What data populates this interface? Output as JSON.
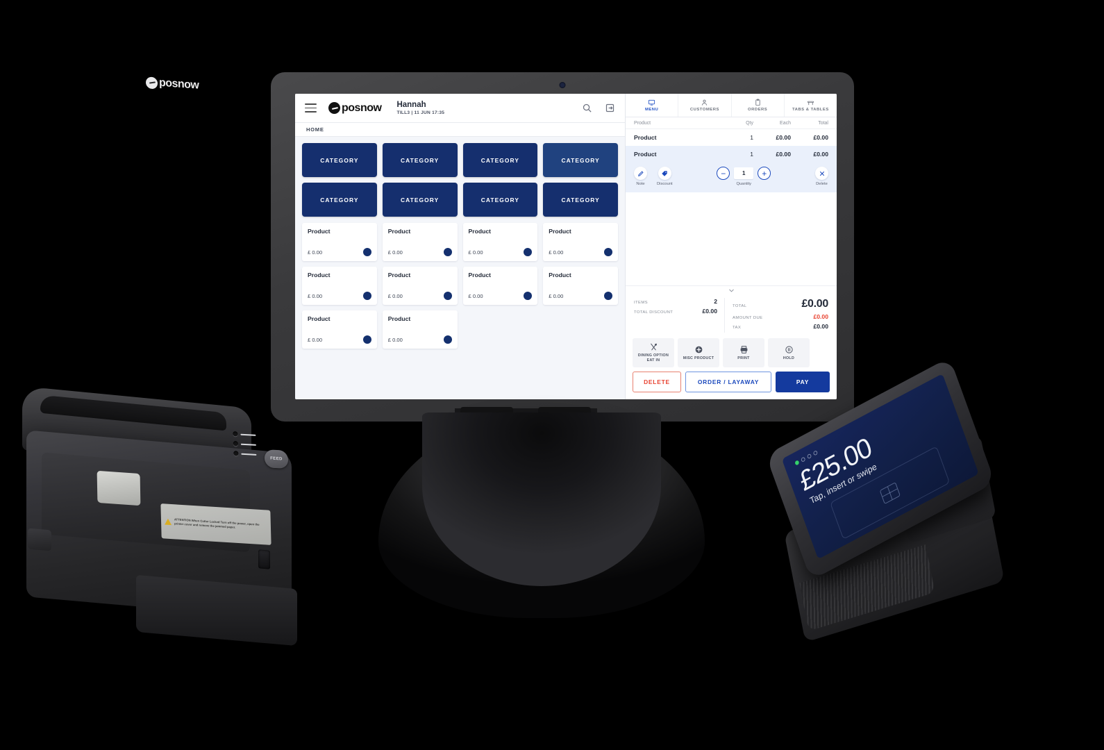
{
  "pos": {
    "header": {
      "menu_icon": "hamburger-icon",
      "brand": "posnow",
      "user_name": "Hannah",
      "till_meta": "TILL3 | 11 JUN 17:35",
      "search_icon": "search-icon",
      "login_icon": "login-icon"
    },
    "breadcrumb": "HOME",
    "categories": [
      {
        "label": "CATEGORY"
      },
      {
        "label": "CATEGORY"
      },
      {
        "label": "CATEGORY"
      },
      {
        "label": "CATEGORY"
      },
      {
        "label": "CATEGORY"
      },
      {
        "label": "CATEGORY"
      },
      {
        "label": "CATEGORY"
      },
      {
        "label": "CATEGORY"
      }
    ],
    "products": [
      {
        "name": "Product",
        "price": "£ 0.00"
      },
      {
        "name": "Product",
        "price": "£ 0.00"
      },
      {
        "name": "Product",
        "price": "£ 0.00"
      },
      {
        "name": "Product",
        "price": "£ 0.00"
      },
      {
        "name": "Product",
        "price": "£ 0.00"
      },
      {
        "name": "Product",
        "price": "£ 0.00"
      },
      {
        "name": "Product",
        "price": "£ 0.00"
      },
      {
        "name": "Product",
        "price": "£ 0.00"
      },
      {
        "name": "Product",
        "price": "£ 0.00"
      },
      {
        "name": "Product",
        "price": "£ 0.00"
      }
    ],
    "tabs": [
      {
        "label": "MENU",
        "icon": "monitor-icon",
        "active": true
      },
      {
        "label": "CUSTOMERS",
        "icon": "person-icon",
        "active": false
      },
      {
        "label": "ORDERS",
        "icon": "clipboard-icon",
        "active": false
      },
      {
        "label": "TABS & TABLES",
        "icon": "table-icon",
        "active": false
      }
    ],
    "cart": {
      "columns": {
        "product": "Product",
        "qty": "Qty",
        "each": "Each",
        "total": "Total"
      },
      "rows": [
        {
          "name": "Product",
          "qty": "1",
          "each": "£0.00",
          "total": "£0.00",
          "selected": false
        },
        {
          "name": "Product",
          "qty": "1",
          "each": "£0.00",
          "total": "£0.00",
          "selected": true
        }
      ],
      "row_actions": {
        "note_label": "Note",
        "discount_label": "Discount",
        "quantity_label": "Quantity",
        "quantity_value": "1",
        "minus_label": "−",
        "plus_label": "+",
        "delete_label": "Delete"
      }
    },
    "totals": {
      "items_label": "ITEMS",
      "items_value": "2",
      "total_discount_label": "TOTAL DISCOUNT",
      "total_discount_value": "£0.00",
      "total_label": "TOTAL",
      "total_value": "£0.00",
      "amount_due_label": "AMOUNT DUE",
      "amount_due_value": "£0.00",
      "tax_label": "TAX",
      "tax_value": "£0.00"
    },
    "quick_actions": [
      {
        "label": "DINING OPTION EAT IN",
        "icon": "cutlery-icon"
      },
      {
        "label": "MISC PRODUCT",
        "icon": "plus-circle-icon"
      },
      {
        "label": "PRINT",
        "icon": "printer-icon"
      },
      {
        "label": "HOLD",
        "icon": "pause-icon"
      }
    ],
    "footer_buttons": {
      "delete": "DELETE",
      "order_layaway": "ORDER / LAYAWAY",
      "pay": "PAY"
    },
    "colors": {
      "brand_navy": "#152f6e",
      "accent_blue": "#1b49bd",
      "pay_blue": "#143a9e",
      "danger_red": "#e8412f",
      "selected_row": "#eaf0fb",
      "page_bg": "#f4f6fa"
    }
  },
  "printer": {
    "brand": "posnow",
    "feed_button": "FEED",
    "warning_label": "ATTENTION   When Cutter Locked\nTurn off the power, open the printer cover\nand remove the jammed paper."
  },
  "terminal": {
    "amount": "£25.00",
    "prompt": "Tap, insert or swipe",
    "indicator_dots": 4,
    "active_dots": 1,
    "screen_color": "#122049"
  }
}
